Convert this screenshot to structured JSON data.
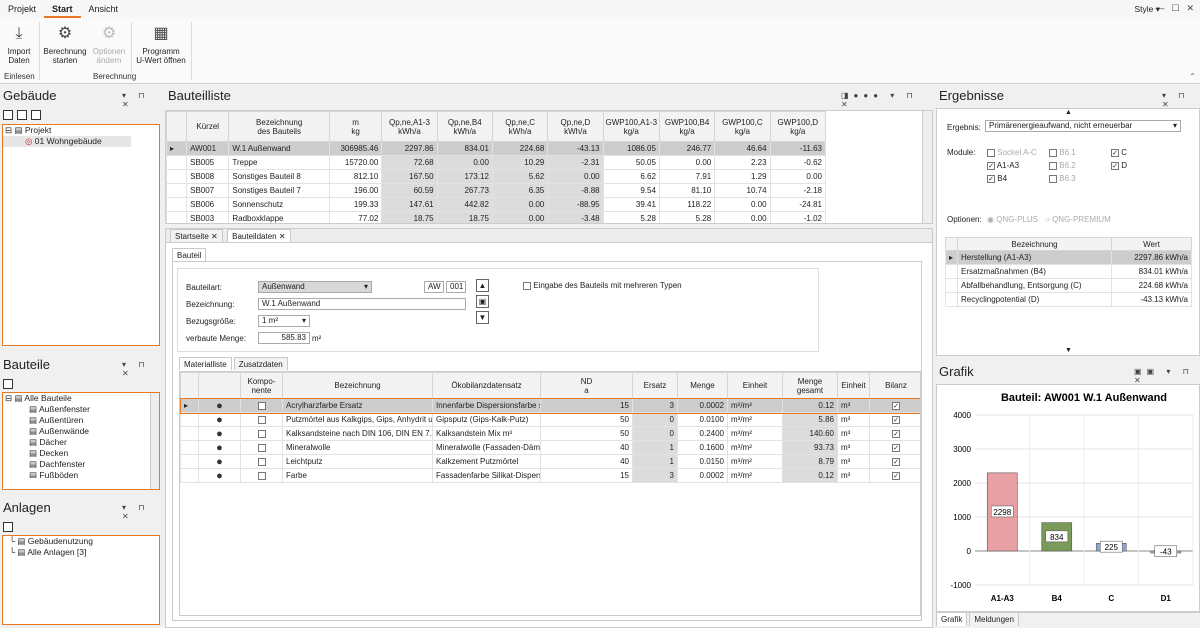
{
  "menu": {
    "projekt": "Projekt",
    "start": "Start",
    "ansicht": "Ansicht",
    "style": "Style"
  },
  "ribbon": {
    "import": "Import\nDaten",
    "import_group": "Einlesen",
    "calc": "Berechnung\nstarten",
    "options": "Optionen\nändern",
    "calc_group": "Berechnung",
    "uwert": "Programm\nU-Wert öffnen"
  },
  "gebaeude": {
    "title": "Gebäude",
    "tree": [
      "Projekt",
      "01 Wohngebäude"
    ]
  },
  "bauteile": {
    "title": "Bauteile",
    "tree": [
      "Alle Bauteile",
      "Außenfenster",
      "Außentüren",
      "Außenwände",
      "Dächer",
      "Decken",
      "Dachfenster",
      "Fußböden"
    ]
  },
  "anlagen": {
    "title": "Anlagen",
    "tree": [
      "Gebäudenutzung",
      "Alle Anlagen [3]"
    ]
  },
  "bauteilliste": {
    "title": "Bauteilliste",
    "headers": [
      "Kürzel",
      "Bezeichnung\ndes Bauteils",
      "m\nkg",
      "Qp,ne,A1-3\nkWh/a",
      "Qp,ne,B4\nkWh/a",
      "Qp,ne,C\nkWh/a",
      "Qp,ne,D\nkWh/a",
      "GWP100,A1-3\nkg/a",
      "GWP100,B4\nkg/a",
      "GWP100,C\nkg/a",
      "GWP100,D\nkg/a"
    ],
    "rows": [
      [
        "AW001",
        "W.1 Außenwand",
        "306985.46",
        "2297.86",
        "834.01",
        "224.68",
        "-43.13",
        "1086.05",
        "246.77",
        "46.64",
        "-11.63"
      ],
      [
        "SB005",
        "Treppe",
        "15720.00",
        "72.68",
        "0.00",
        "10.29",
        "-2.31",
        "50.05",
        "0.00",
        "2.23",
        "-0.62"
      ],
      [
        "SB008",
        "Sonstiges Bauteil 8",
        "812.10",
        "167.50",
        "173.12",
        "5.62",
        "0.00",
        "6.62",
        "7.91",
        "1.29",
        "0.00"
      ],
      [
        "SB007",
        "Sonstiges Bauteil 7",
        "196.00",
        "60.59",
        "267.73",
        "6.35",
        "-8.88",
        "9.54",
        "81.10",
        "10.74",
        "-2.18"
      ],
      [
        "SB006",
        "Sonnenschutz",
        "199.33",
        "147.61",
        "442.82",
        "0.00",
        "-88.95",
        "39.41",
        "118.22",
        "0.00",
        "-24.81"
      ],
      [
        "SB003",
        "Radboxklappe",
        "77.02",
        "18.75",
        "18.75",
        "0.00",
        "-3.48",
        "5.28",
        "5.28",
        "0.00",
        "-1.02"
      ]
    ]
  },
  "doctabs": {
    "start": "Startseite",
    "bauteildaten": "Bauteildaten"
  },
  "form": {
    "tab": "Bauteil",
    "bauteilart_label": "Bauteilart:",
    "bauteilart": "Außenwand",
    "code1": "AW",
    "code2": "001",
    "bezeichnung_label": "Bezeichnung:",
    "bezeichnung": "W.1 Außenwand",
    "bezugsgroesse_label": "Bezugsgröße:",
    "bezugsgroesse": "1 m²",
    "menge_label": "verbaute Menge:",
    "menge": "585.83",
    "menge_unit": "m²",
    "mehrere_typen": "Eingabe des Bauteils mit mehreren Typen"
  },
  "materials": {
    "tabs": [
      "Materialliste",
      "Zusatzdaten"
    ],
    "headers": [
      "Kompo-\nnente",
      "Bezeichnung",
      "Ökobilanzdatensatz",
      "ND\na",
      "Ersatz",
      "Menge",
      "Einheit",
      "Menge\ngesamt",
      "Einheit",
      "Bilanz"
    ],
    "rows": [
      [
        "Acrylharzfarbe Ersatz",
        "Innenfarbe Dispersionsfarbe s...",
        "15",
        "3",
        "0.0002",
        "m²/m²",
        "0.12",
        "m³"
      ],
      [
        "Putzmörtel aus Kalkgips, Gips, Anhydrit un...",
        "Gipsputz (Gips-Kalk-Putz)",
        "50",
        "0",
        "0.0100",
        "m³/m²",
        "5.86",
        "m³"
      ],
      [
        "Kalksandsteine nach DIN 106, DIN EN 7...",
        "Kalksandstein Mix m³",
        "50",
        "0",
        "0.2400",
        "m³/m²",
        "140.60",
        "m³"
      ],
      [
        "Mineralwolle",
        "Mineralwolle (Fassaden-Däm...",
        "40",
        "1",
        "0.1600",
        "m³/m²",
        "93.73",
        "m³"
      ],
      [
        "Leichtputz",
        "Kalkzement Putzmörtel",
        "40",
        "1",
        "0.0150",
        "m³/m²",
        "8.79",
        "m³"
      ],
      [
        "Farbe",
        "Fassadenfarbe Silikat-Dispersi...",
        "15",
        "3",
        "0.0002",
        "m³/m²",
        "0.12",
        "m³"
      ]
    ]
  },
  "ergebnisse": {
    "title": "Ergebnisse",
    "ergebnis_label": "Ergebnis:",
    "ergebnis": "Primärenergieaufwand, nicht erneuerbar",
    "module_label": "Module:",
    "modules": [
      {
        "label": "Sockel A-C",
        "checked": false,
        "enabled": false
      },
      {
        "label": "B6.1",
        "checked": false,
        "enabled": false
      },
      {
        "label": "C",
        "checked": true,
        "enabled": true
      },
      {
        "label": "A1-A3",
        "checked": true,
        "enabled": true
      },
      {
        "label": "B6.2",
        "checked": false,
        "enabled": false
      },
      {
        "label": "D",
        "checked": true,
        "enabled": true
      },
      {
        "label": "B4",
        "checked": true,
        "enabled": true
      },
      {
        "label": "B6.3",
        "checked": false,
        "enabled": false
      }
    ],
    "optionen_label": "Optionen:",
    "opt1": "QNG-PLUS",
    "opt2": "QNG-PREMIUM",
    "headers": [
      "Bezeichnung",
      "Wert"
    ],
    "rows": [
      [
        "Herstellung (A1-A3)",
        "2297.86 kWh/a"
      ],
      [
        "Ersatzmaßnahmen (B4)",
        "834.01 kWh/a"
      ],
      [
        "Abfallbehandlung, Entsorgung (C)",
        "224.68 kWh/a"
      ],
      [
        "Recyclingpotential (D)",
        "-43.13 kWh/a"
      ]
    ]
  },
  "grafik": {
    "title": "Grafik",
    "tabs": [
      "Grafik",
      "Meldungen"
    ]
  },
  "chart_data": {
    "type": "bar",
    "title": "Bauteil: AW001 W.1 Außenwand",
    "categories": [
      "A1-A3",
      "B4",
      "C",
      "D1"
    ],
    "values": [
      2298,
      834,
      225,
      -43
    ],
    "ylim": [
      -1000,
      4000
    ],
    "yticks": [
      -1000,
      0,
      1000,
      2000,
      3000,
      4000
    ],
    "colors": [
      "#e8a0a4",
      "#7a9a5a",
      "#8fa6d8",
      "#e8b070"
    ],
    "grid": true
  }
}
